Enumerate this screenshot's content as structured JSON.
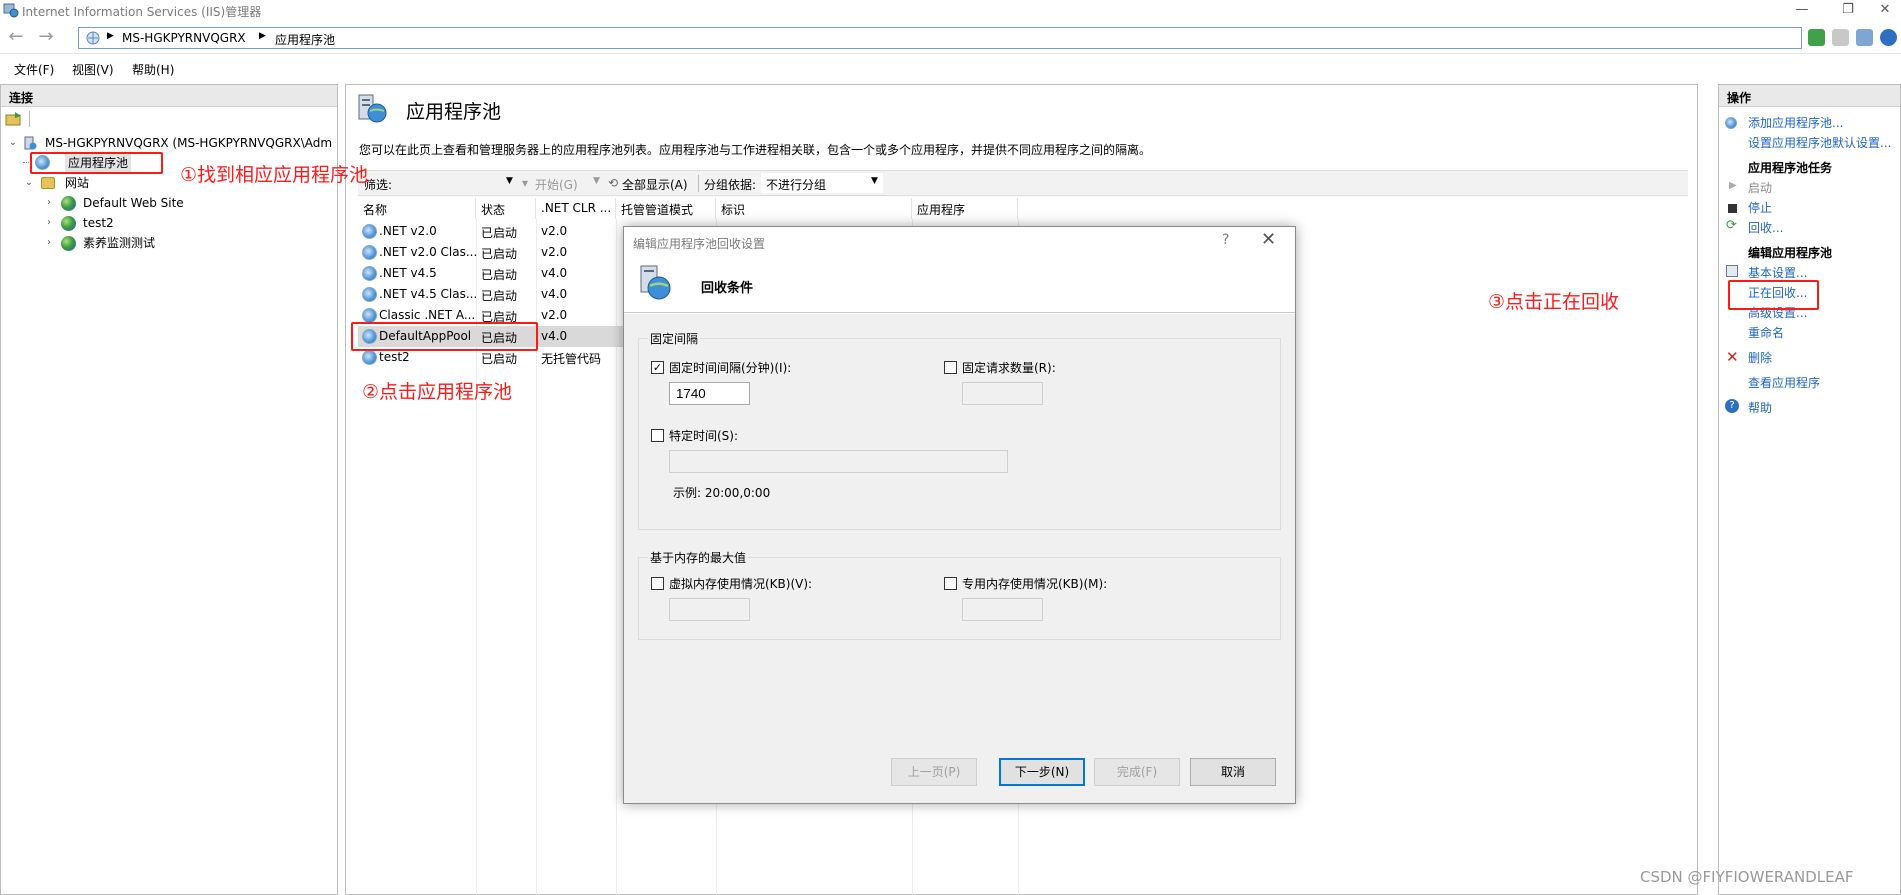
{
  "window": {
    "title": "Internet Information Services (IIS)管理器",
    "controls": [
      "—",
      "❐",
      "✕"
    ]
  },
  "address": {
    "crumbs": [
      "MS-HGKPYRNVQGRX",
      "应用程序池"
    ]
  },
  "menu": [
    "文件(F)",
    "视图(V)",
    "帮助(H)"
  ],
  "connections": {
    "header": "连接",
    "server": "MS-HGKPYRNVQGRX (MS-HGKPYRNVQGRX\\Adm",
    "app_pools": "应用程序池",
    "sites": "网站",
    "site_items": [
      "Default Web Site",
      "test2",
      "素养监测测试"
    ]
  },
  "main": {
    "title": "应用程序池",
    "description": "您可以在此页上查看和管理服务器上的应用程序池列表。应用程序池与工作进程相关联，包含一个或多个应用程序，并提供不同应用程序之间的隔离。",
    "filter": {
      "label": "筛选:",
      "start": "开始(G)",
      "show_all": "全部显示(A)",
      "group_by_label": "分组依据:",
      "group_by_value": "不进行分组"
    },
    "columns": [
      "名称",
      "状态",
      ".NET CLR ...",
      "托管管道模式",
      "标识",
      "应用程序"
    ],
    "rows": [
      {
        "name": ".NET v2.0",
        "status": "已启动",
        "clr": "v2.0"
      },
      {
        "name": ".NET v2.0 Clas...",
        "status": "已启动",
        "clr": "v2.0"
      },
      {
        "name": ".NET v4.5",
        "status": "已启动",
        "clr": "v4.0"
      },
      {
        "name": ".NET v4.5 Clas...",
        "status": "已启动",
        "clr": "v4.0"
      },
      {
        "name": "Classic .NET A...",
        "status": "已启动",
        "clr": "v2.0"
      },
      {
        "name": "DefaultAppPool",
        "status": "已启动",
        "clr": "v4.0"
      },
      {
        "name": "test2",
        "status": "已启动",
        "clr": "无托管代码"
      }
    ]
  },
  "dialog": {
    "title": "编辑应用程序池回收设置",
    "help": "?",
    "close": "✕",
    "header": "回收条件",
    "group_fixed": "固定间隔",
    "fixed_interval_label": "固定时间间隔(分钟)(I):",
    "fixed_interval_checked": true,
    "fixed_interval_value": "1740",
    "fixed_requests_label": "固定请求数量(R):",
    "fixed_requests_checked": false,
    "specific_time_label": "特定时间(S):",
    "specific_time_checked": false,
    "example": "示例: 20:00,0:00",
    "group_memory": "基于内存的最大值",
    "virtual_mem_label": "虚拟内存使用情况(KB)(V):",
    "private_mem_label": "专用内存使用情况(KB)(M):",
    "buttons": {
      "prev": "上一页(P)",
      "next": "下一步(N)",
      "finish": "完成(F)",
      "cancel": "取消"
    }
  },
  "actions": {
    "header": "操作",
    "add_pool": "添加应用程序池...",
    "set_defaults": "设置应用程序池默认设置...",
    "tasks_head": "应用程序池任务",
    "start": "启动",
    "stop": "停止",
    "recycle": "回收...",
    "edit_head": "编辑应用程序池",
    "basic": "基本设置...",
    "recycling": "正在回收...",
    "advanced": "高级设置...",
    "rename": "重命名",
    "delete": "删除",
    "view_apps": "查看应用程序",
    "help": "帮助"
  },
  "annotations": {
    "step1": "①找到相应应用程序池",
    "step2": "②点击应用程序池",
    "step3": "③点击正在回收",
    "color": "#ff1a1a"
  },
  "watermark": "CSDN @FIYFIOWERANDLEAF"
}
